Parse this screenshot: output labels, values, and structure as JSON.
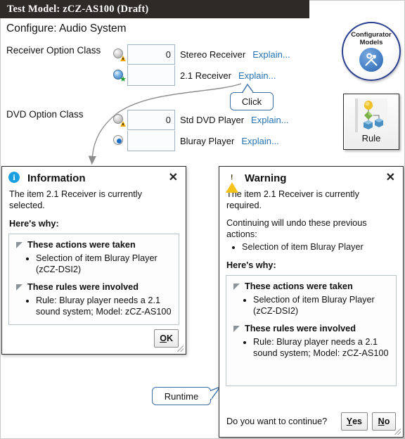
{
  "window": {
    "title": "Test Model: zCZ-AS100 (Draft)"
  },
  "page": {
    "configure_heading": "Configure: Audio System"
  },
  "option_classes": [
    {
      "label": "Receiver Option Class",
      "options": [
        {
          "icon": "sphere-warning-icon",
          "qty": "0",
          "name": "Stereo Receiver",
          "explain": "Explain..."
        },
        {
          "icon": "sphere-blue-star-icon",
          "qty": "",
          "name": "2.1 Receiver",
          "explain": "Explain..."
        }
      ]
    },
    {
      "label": "DVD Option Class",
      "options": [
        {
          "icon": "sphere-warning-icon",
          "qty": "0",
          "name": "Std DVD Player",
          "explain": "Explain..."
        },
        {
          "icon": "radio-selected-icon",
          "qty": "",
          "name": "Bluray Player",
          "explain": "Explain..."
        }
      ]
    }
  ],
  "badges": {
    "configurator": {
      "line1": "Configurator",
      "line2": "Models",
      "icon": "tools-icon"
    },
    "rule_button": {
      "label": "Rule",
      "icon": "rule-diagram-icon"
    }
  },
  "callouts": {
    "click": "Click",
    "runtime": "Runtime"
  },
  "info_dialog": {
    "icon": "info-icon",
    "title": "Information",
    "close": "✕",
    "message": "The item 2.1 Receiver is currently selected.",
    "why_label": "Here's why:",
    "sections": [
      {
        "heading": "These actions were taken",
        "items": [
          "Selection of item Bluray Player (zCZ-DSI2)"
        ]
      },
      {
        "heading": "These rules were involved",
        "items": [
          "Rule: Bluray player needs a 2.1 sound system; Model: zCZ-AS100"
        ]
      }
    ],
    "ok_button": "OK"
  },
  "warning_dialog": {
    "icon": "warning-icon",
    "title": "Warning",
    "close": "✕",
    "message": "The item 2.1 Receiver is currently required.",
    "undo_intro": "Continuing will undo these previous actions:",
    "undo_items": [
      "Selection of item Bluray Player"
    ],
    "why_label": "Here's why:",
    "sections": [
      {
        "heading": "These actions were taken",
        "items": [
          "Selection of item Bluray Player (zCZ-DSI2)"
        ]
      },
      {
        "heading": "These rules were involved",
        "items": [
          "Rule: Bluray player needs a 2.1 sound system; Model: zCZ-AS100"
        ]
      }
    ],
    "question": "Do you want to continue?",
    "yes_button": "Yes",
    "no_button": "No"
  },
  "colors": {
    "titlebar_bg": "#2e2a27",
    "link": "#2673b4",
    "info_icon": "#1a9fe0",
    "warning_icon": "#f5c21a",
    "callout_border": "#3a6ea5",
    "selection_blue": "#1b6fc4"
  }
}
